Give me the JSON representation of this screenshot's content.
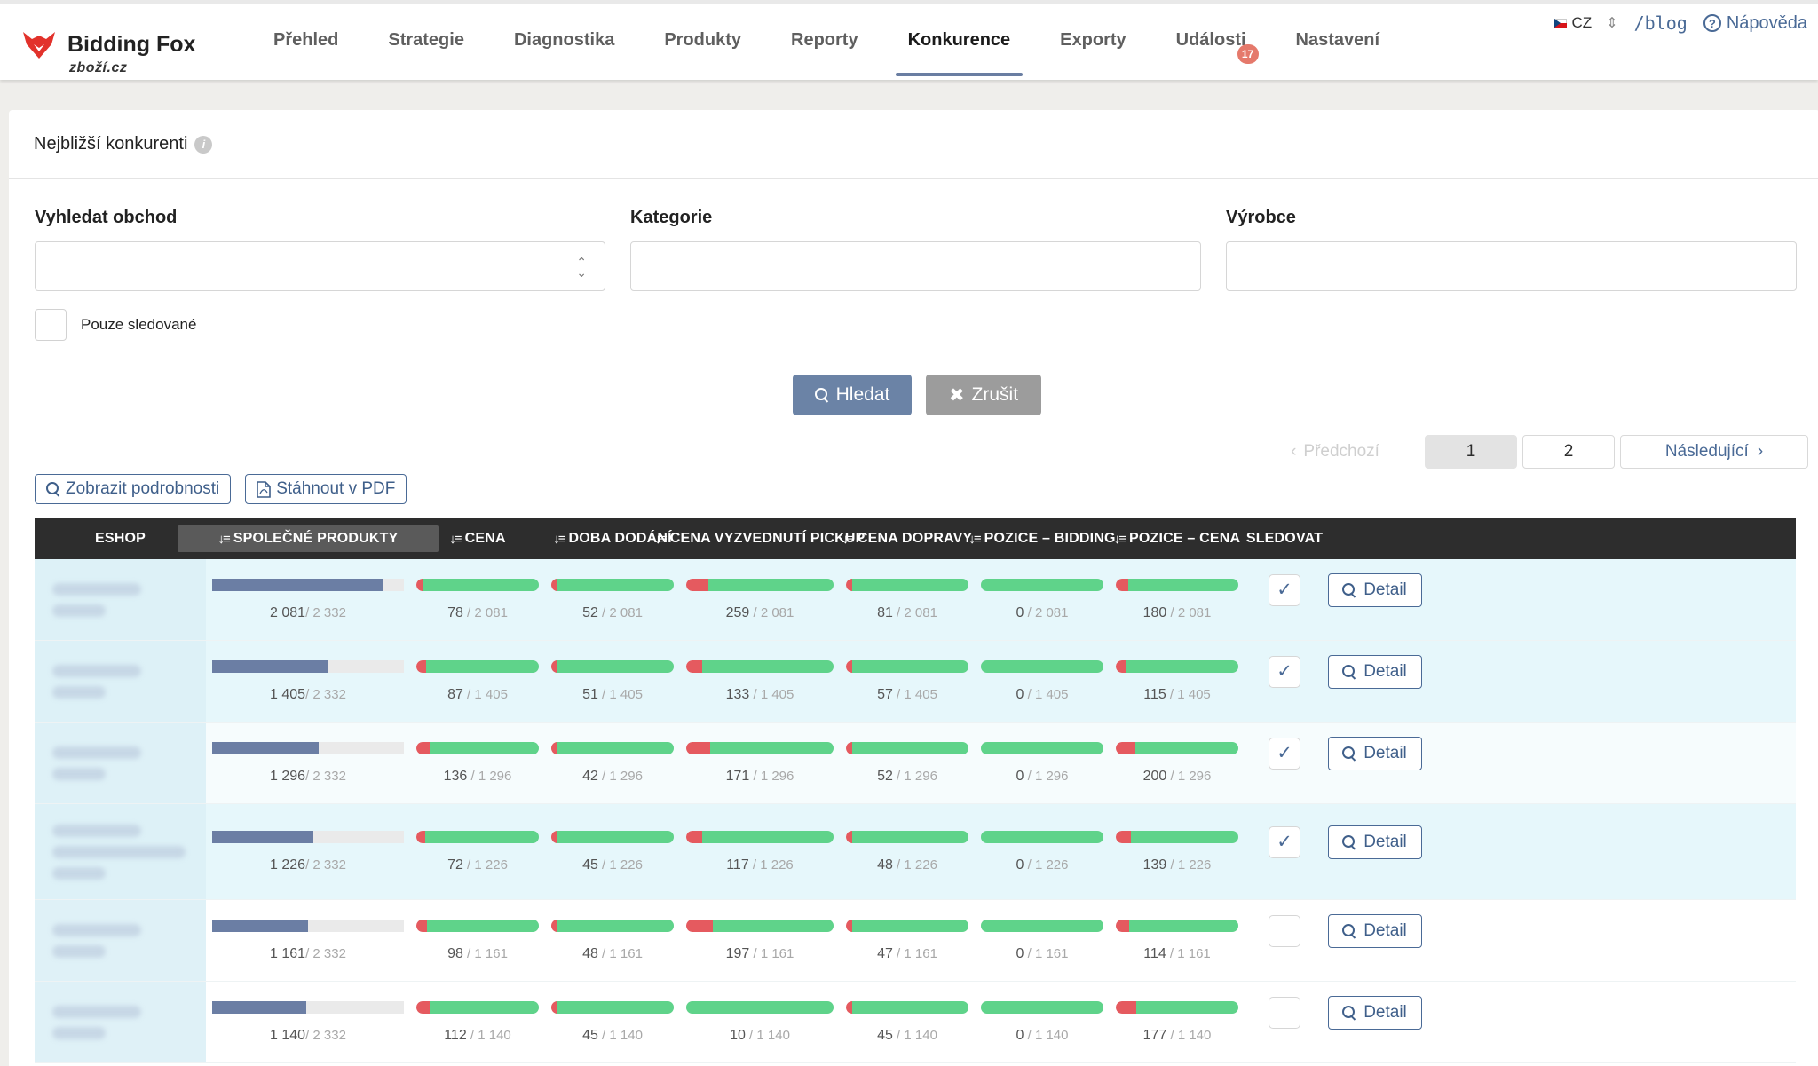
{
  "brand": {
    "title": "Bidding Fox",
    "subtitle": "zboží.cz",
    "accent": "#6a7ea2"
  },
  "nav": [
    {
      "label": "Přehled",
      "active": false
    },
    {
      "label": "Strategie",
      "active": false
    },
    {
      "label": "Diagnostika",
      "active": false
    },
    {
      "label": "Produkty",
      "active": false
    },
    {
      "label": "Reporty",
      "active": false
    },
    {
      "label": "Konkurence",
      "active": true
    },
    {
      "label": "Exporty",
      "active": false
    },
    {
      "label": "Události",
      "active": false,
      "badge": "17"
    },
    {
      "label": "Nastavení",
      "active": false
    }
  ],
  "topright": {
    "lang": "CZ",
    "blog": "/blog",
    "help": "Nápověda"
  },
  "panel": {
    "title": "Nejbližší konkurenti"
  },
  "filters": [
    {
      "label": "Vyhledat obchod",
      "type": "select",
      "value": ""
    },
    {
      "label": "Kategorie",
      "type": "text",
      "value": ""
    },
    {
      "label": "Výrobce",
      "type": "text",
      "value": ""
    }
  ],
  "watch_only_label": "Pouze sledované",
  "buttons": {
    "search": "Hledat",
    "cancel": "Zrušit"
  },
  "pager": {
    "prev": "Předchozí",
    "pages": [
      "1",
      "2"
    ],
    "current": "1",
    "next": "Následující"
  },
  "tools": {
    "details": "Zobrazit podrobnosti",
    "pdf": "Stáhnout v PDF"
  },
  "table": {
    "columns": [
      "ESHOP",
      "SPOLEČNÉ PRODUKTY",
      "CENA",
      "DOBA DODÁNÍ",
      "CENA VYZVEDNUTÍ PICKUP",
      "CENA DOPRAVY",
      "POZICE – BIDDING",
      "POZICE – CENA",
      "SLEDOVAT"
    ],
    "sorted_column": "SPOLEČNÉ PRODUKTY",
    "shared_total": "2 332",
    "detail_label": "Detail",
    "watch_check": "✓",
    "rows": [
      {
        "shared": "2 081",
        "shared_frac": 0.892,
        "cena": "78",
        "doba": "52",
        "pickup": "259",
        "doprava": "81",
        "bid": "0",
        "poz": "180",
        "total": "2 081",
        "red": {
          "cena": 0.04,
          "doba": 0.03,
          "pickup": 0.14,
          "doprava": 0.04,
          "bid": 0.0,
          "poz": 0.09
        },
        "watched": true,
        "style": "cyan",
        "lines": 2
      },
      {
        "shared": "1 405",
        "shared_frac": 0.602,
        "cena": "87",
        "doba": "51",
        "pickup": "133",
        "doprava": "57",
        "bid": "0",
        "poz": "115",
        "total": "1 405",
        "red": {
          "cena": 0.07,
          "doba": 0.03,
          "pickup": 0.1,
          "doprava": 0.04,
          "bid": 0.0,
          "poz": 0.08
        },
        "watched": true,
        "style": "cyan",
        "lines": 2
      },
      {
        "shared": "1 296",
        "shared_frac": 0.556,
        "cena": "136",
        "doba": "42",
        "pickup": "171",
        "doprava": "52",
        "bid": "0",
        "poz": "200",
        "total": "1 296",
        "red": {
          "cena": 0.1,
          "doba": 0.03,
          "pickup": 0.15,
          "doprava": 0.04,
          "bid": 0.0,
          "poz": 0.15
        },
        "watched": true,
        "style": "plain",
        "lines": 2
      },
      {
        "shared": "1 226",
        "shared_frac": 0.526,
        "cena": "72",
        "doba": "45",
        "pickup": "117",
        "doprava": "48",
        "bid": "0",
        "poz": "139",
        "total": "1 226",
        "red": {
          "cena": 0.06,
          "doba": 0.03,
          "pickup": 0.1,
          "doprava": 0.04,
          "bid": 0.0,
          "poz": 0.11
        },
        "watched": true,
        "style": "cyan",
        "lines": 3
      },
      {
        "shared": "1 161",
        "shared_frac": 0.498,
        "cena": "98",
        "doba": "48",
        "pickup": "197",
        "doprava": "47",
        "bid": "0",
        "poz": "114",
        "total": "1 161",
        "red": {
          "cena": 0.08,
          "doba": 0.03,
          "pickup": 0.17,
          "doprava": 0.04,
          "bid": 0.0,
          "poz": 0.1
        },
        "watched": false,
        "style": "white",
        "lines": 2
      },
      {
        "shared": "1 140",
        "shared_frac": 0.489,
        "cena": "112",
        "doba": "45",
        "pickup": "10",
        "doprava": "45",
        "bid": "0",
        "poz": "177",
        "total": "1 140",
        "red": {
          "cena": 0.1,
          "doba": 0.03,
          "pickup": 0.0,
          "doprava": 0.04,
          "bid": 0.0,
          "poz": 0.16
        },
        "watched": false,
        "style": "white",
        "lines": 2
      }
    ]
  }
}
